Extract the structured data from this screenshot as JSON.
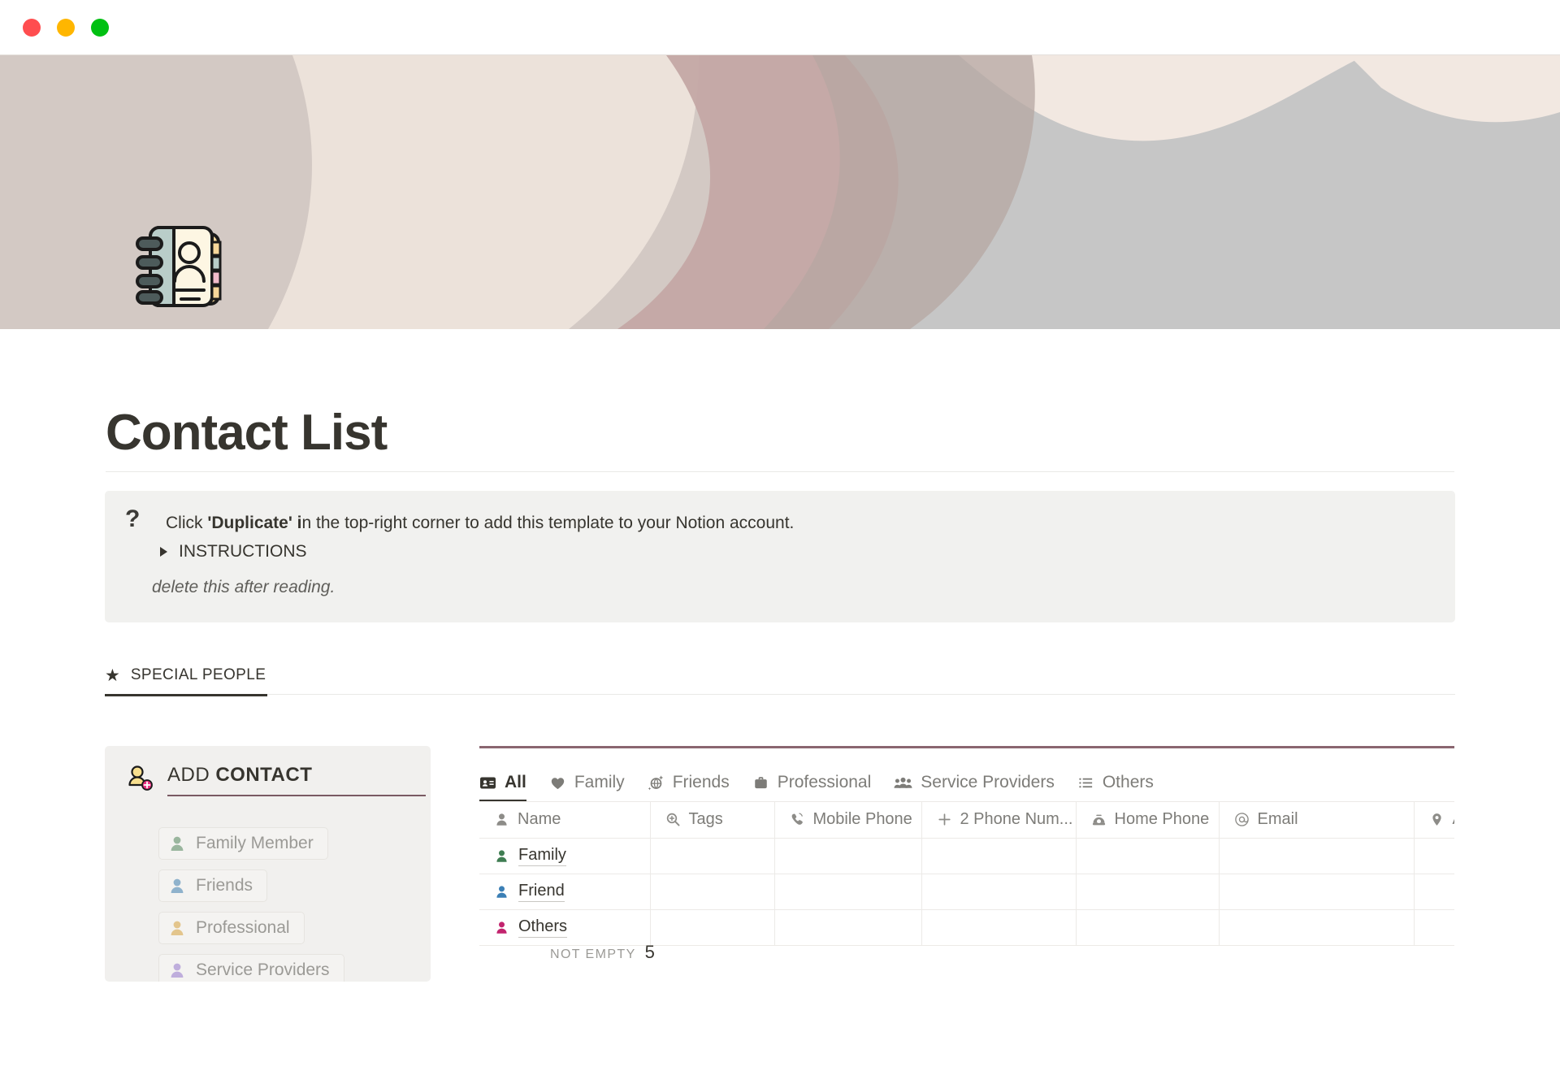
{
  "window": {
    "traffic_lights": [
      {
        "name": "close",
        "color": "#ff4d4f"
      },
      {
        "name": "minimize",
        "color": "#ffb600"
      },
      {
        "name": "zoom",
        "color": "#00c012"
      }
    ]
  },
  "cover": {
    "name": "abstract-organic-shapes-cover",
    "colors": {
      "base": "#d3c9c4",
      "cream": "#f0e7e0",
      "mauve": "#c6a9a6",
      "rose": "#c4a8a5",
      "taupe": "#b9a9a3",
      "gray": "#c6c6c6",
      "gray_dark": "#b9b4ae"
    }
  },
  "page": {
    "icon_name": "contact-book-emoji",
    "title": "Contact List"
  },
  "callout": {
    "icon": "question-mark-icon",
    "line1_prefix": "Click ",
    "line1_bold": "'Duplicate' i",
    "line1_suffix": "n the top-right corner to add this template to your Notion account.",
    "toggle_label": "INSTRUCTIONS",
    "note": "delete this after reading."
  },
  "tabs": {
    "special_people": {
      "icon": "star-icon",
      "label": "SPECIAL PEOPLE",
      "active": true
    }
  },
  "add_contact": {
    "icon": "add-person-icon",
    "title_prefix": "ADD ",
    "title_bold": "CONTACT",
    "accent_color": "#7a5a63",
    "chips": [
      {
        "label": "Family Member",
        "icon": "person-icon",
        "color": "#9ab69e"
      },
      {
        "label": "Friends",
        "icon": "person-icon",
        "color": "#8fb2cc"
      },
      {
        "label": "Professional",
        "icon": "person-icon",
        "color": "#e3c58c"
      },
      {
        "label": "Service Providers",
        "icon": "person-icon",
        "color": "#bfaedc"
      }
    ]
  },
  "database": {
    "accent_line_color": "#8a6670",
    "views": [
      {
        "label": "All",
        "icon": "id-card-icon",
        "active": true
      },
      {
        "label": "Family",
        "icon": "heart-icon",
        "active": false
      },
      {
        "label": "Friends",
        "icon": "sparkle-globe-icon",
        "active": false
      },
      {
        "label": "Professional",
        "icon": "briefcase-icon",
        "active": false
      },
      {
        "label": "Service Providers",
        "icon": "people-icon",
        "active": false
      },
      {
        "label": "Others",
        "icon": "list-icon",
        "active": false
      }
    ],
    "columns": [
      {
        "label": "Name",
        "icon": "person-icon"
      },
      {
        "label": "Tags",
        "icon": "magnifier-plus-icon"
      },
      {
        "label": "Mobile Phone",
        "icon": "mobile-phone-icon"
      },
      {
        "label": "2 Phone Num...",
        "icon": "plus-icon"
      },
      {
        "label": "Home Phone",
        "icon": "rotary-phone-icon"
      },
      {
        "label": "Email",
        "icon": "at-icon"
      },
      {
        "label": "A",
        "icon": "map-pin-icon"
      }
    ],
    "rows": [
      {
        "name": "Family",
        "dot_color": "#3f7d52",
        "tags": "",
        "mobile_phone": "",
        "phone_numbers": "",
        "home_phone": "",
        "email": "",
        "address": ""
      },
      {
        "name": "Friend",
        "dot_color": "#3b7fb5",
        "tags": "",
        "mobile_phone": "",
        "phone_numbers": "",
        "home_phone": "",
        "email": "",
        "address": ""
      },
      {
        "name": "Others",
        "dot_color": "#c2246e",
        "tags": "",
        "mobile_phone": "",
        "phone_numbers": "",
        "home_phone": "",
        "email": "",
        "address": ""
      }
    ],
    "footer": {
      "label": "NOT EMPTY",
      "value": "5"
    }
  }
}
